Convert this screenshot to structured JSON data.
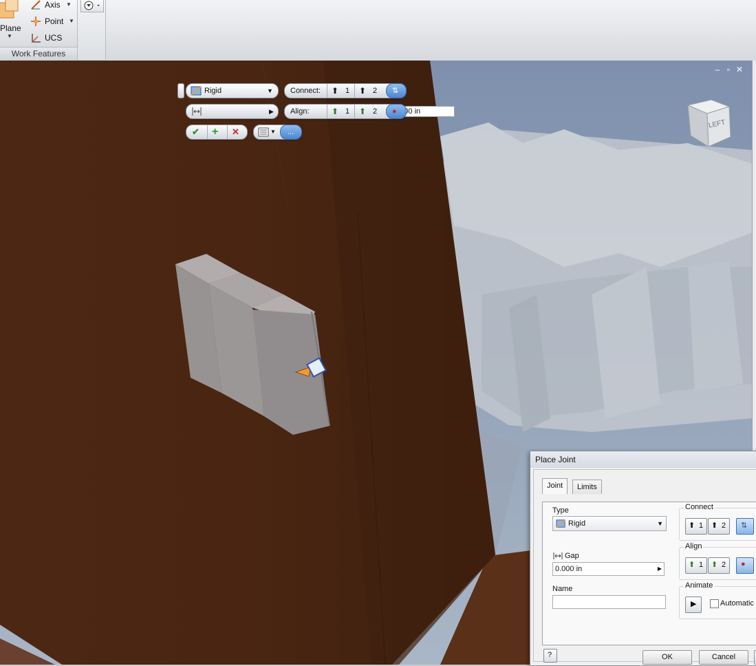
{
  "ribbon": {
    "work_features": {
      "title": "Work Features",
      "plane_label": "Plane",
      "axis_label": "Axis",
      "point_label": "Point",
      "ucs_label": "UCS"
    }
  },
  "viewcube": {
    "face_label": "LEFT"
  },
  "mini_toolbar": {
    "type_value": "Rigid",
    "gap_value": "0.000 in",
    "connect_label": "Connect:",
    "align_label": "Align:",
    "connect_1": "1",
    "connect_2": "2",
    "align_1": "1",
    "align_2": "2",
    "more_label": "..."
  },
  "dialog": {
    "title": "Place Joint",
    "tabs": [
      "Joint",
      "Limits"
    ],
    "type_label": "Type",
    "type_value": "Rigid",
    "gap_label": "Gap",
    "gap_value": "0.000 in",
    "name_label": "Name",
    "name_value": "",
    "connect_group": "Connect",
    "connect_1": "1",
    "connect_2": "2",
    "align_group": "Align",
    "align_1": "1",
    "align_2": "2",
    "animate_group": "Animate",
    "automatic_label": "Automatic P",
    "ok_label": "OK",
    "cancel_label": "Cancel"
  },
  "colors": {
    "wood": "#4a2612",
    "wood_dark": "#3b1d0d",
    "accent_blue": "#4c86cf",
    "accept_green": "#2f9a2f",
    "cancel_red": "#c8262c"
  }
}
